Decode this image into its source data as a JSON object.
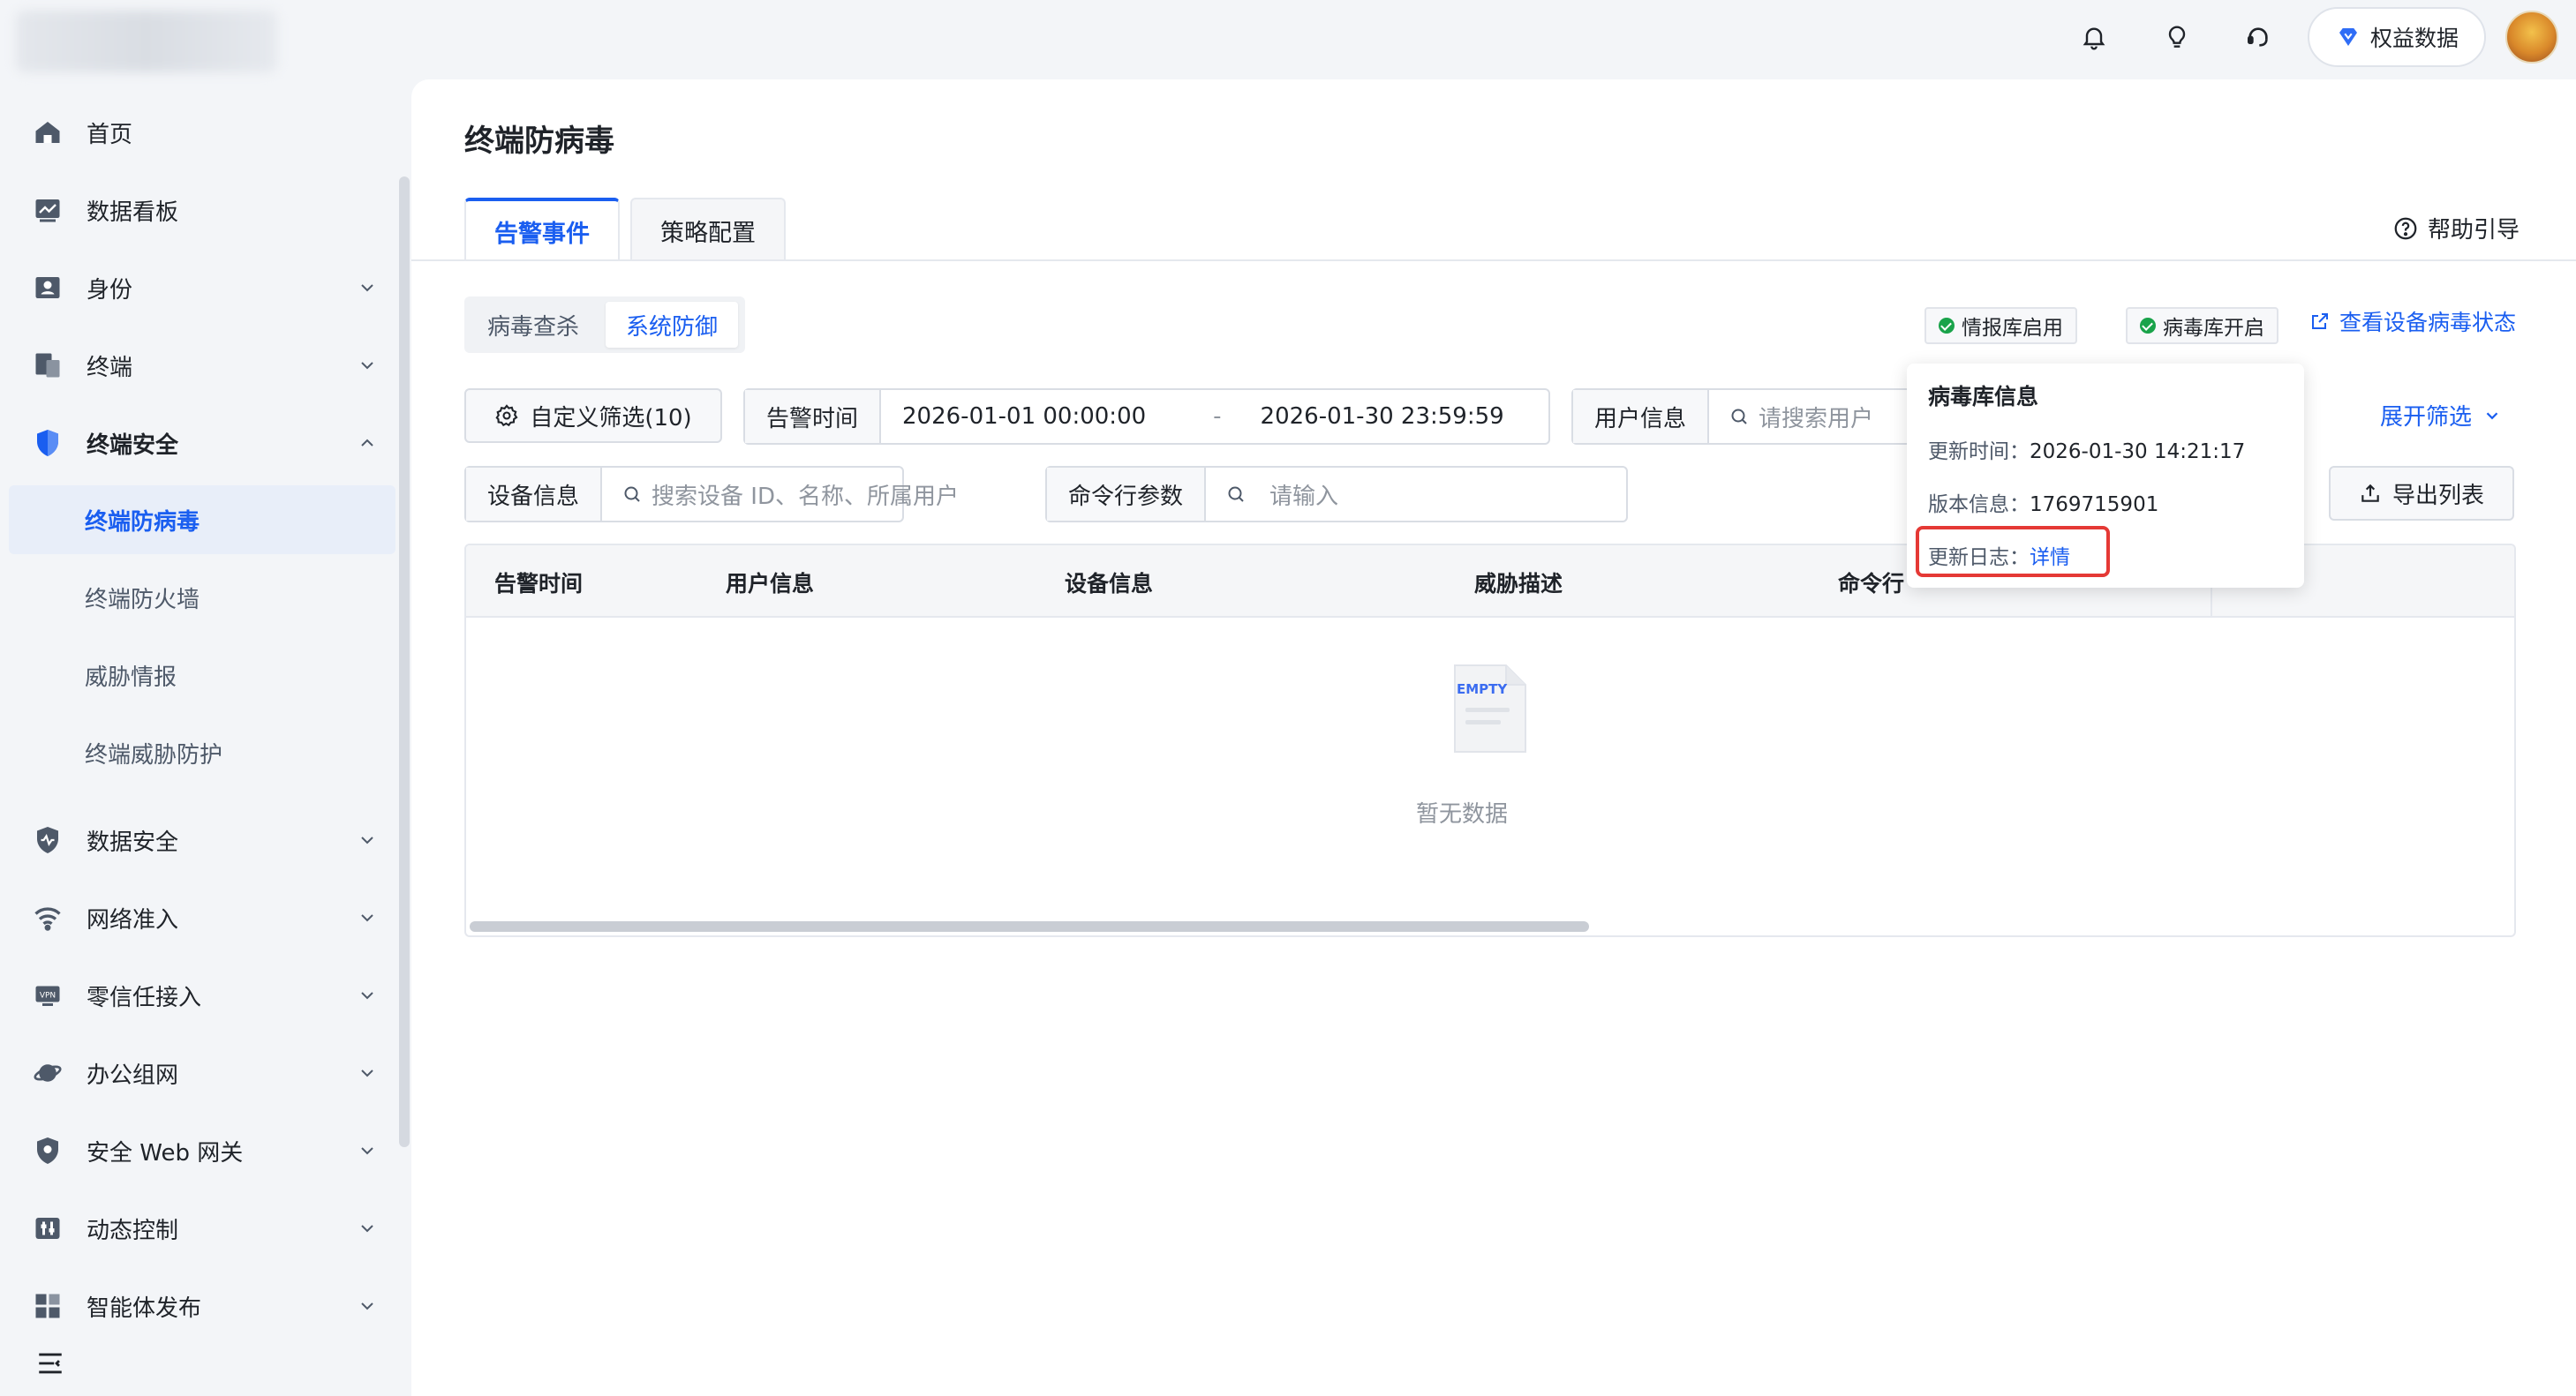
{
  "topbar": {
    "rights_label": "权益数据",
    "icons": [
      "bell-icon",
      "lightbulb-icon",
      "headset-icon",
      "diamond-icon"
    ]
  },
  "sidebar": {
    "items": [
      {
        "label": "首页",
        "icon": "home-icon"
      },
      {
        "label": "数据看板",
        "icon": "dashboard-icon"
      },
      {
        "label": "身份",
        "icon": "id-card-icon"
      },
      {
        "label": "终端",
        "icon": "devices-icon"
      },
      {
        "label": "终端安全",
        "icon": "shield-icon"
      },
      {
        "label": "数据安全",
        "icon": "data-shield-icon"
      },
      {
        "label": "网络准入",
        "icon": "wifi-icon"
      },
      {
        "label": "零信任接入",
        "icon": "vpn-icon"
      },
      {
        "label": "办公组网",
        "icon": "planet-icon"
      },
      {
        "label": "安全 Web 网关",
        "icon": "gateway-shield-icon"
      },
      {
        "label": "动态控制",
        "icon": "controls-icon"
      },
      {
        "label": "智能体发布",
        "icon": "apps-icon"
      }
    ],
    "sub_items": [
      {
        "label": "终端防病毒",
        "active": true
      },
      {
        "label": "终端防火墙",
        "active": false
      },
      {
        "label": "威胁情报",
        "active": false
      },
      {
        "label": "终端威胁防护",
        "active": false
      }
    ]
  },
  "main": {
    "title": "终端防病毒",
    "tabs": [
      {
        "label": "告警事件",
        "active": true
      },
      {
        "label": "策略配置",
        "active": false
      }
    ],
    "help_label": "帮助引导",
    "segments": [
      {
        "label": "病毒查杀",
        "active": false
      },
      {
        "label": "系统防御",
        "active": true
      }
    ],
    "badges": [
      {
        "label": "情报库启用"
      },
      {
        "label": "病毒库开启"
      }
    ],
    "status_link": "查看设备病毒状态"
  },
  "filters": {
    "custom_filter": "自定义筛选(10)",
    "alert_time_label": "告警时间",
    "start_time": "2026-01-01 00:00:00",
    "separator": "-",
    "end_time": "2026-01-30 23:59:59",
    "user_label": "用户信息",
    "user_placeholder": "请搜索用户",
    "device_label": "设备信息",
    "device_placeholder": "搜索设备 ID、名称、所属用户",
    "cmd_label": "命令行参数",
    "cmd_placeholder": "请输入",
    "expand_label": "展开筛选",
    "export_label": "导出列表"
  },
  "table": {
    "columns": [
      "告警时间",
      "用户信息",
      "设备信息",
      "威胁描述",
      "命令行"
    ],
    "empty_text": "暂无数据",
    "empty_badge": "EMPTY"
  },
  "popover": {
    "title": "病毒库信息",
    "update_time_label": "更新时间：",
    "update_time": "2026-01-30 14:21:17",
    "version_label": "版本信息：",
    "version": "1769715901",
    "log_label": "更新日志：",
    "log_link": "详情"
  },
  "colors": {
    "accent": "#1a5ef0",
    "success": "#19a34a",
    "highlight": "#e53935"
  }
}
